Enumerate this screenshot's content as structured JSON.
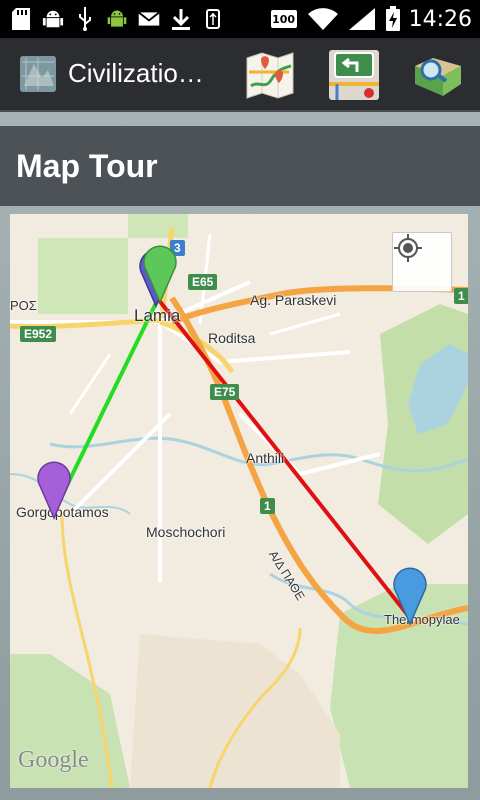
{
  "status_bar": {
    "time": "14:26",
    "battery_label": "100",
    "icons": [
      "sd-card-icon",
      "android-debug-icon",
      "usb-icon",
      "android-icon",
      "gmail-icon",
      "download-icon",
      "usb-connected-icon",
      "battery-100-icon",
      "wifi-icon",
      "signal-icon",
      "battery-charging-icon"
    ]
  },
  "action_bar": {
    "app_title": "Civilizatio…",
    "actions": [
      "map-route-icon",
      "navigation-icon",
      "map-search-icon"
    ]
  },
  "page": {
    "title": "Map Tour"
  },
  "map": {
    "labels": {
      "lamia": "Lamia",
      "ag_paraskevi": "Ag. Paraskevi",
      "roditsa": "Roditsa",
      "anthili": "Anthili",
      "gorgopotamos": "Gorgopotamos",
      "moschochori": "Moschochori",
      "thermopylae": "Thermopylae",
      "road_ay": "Α/Δ ΠΑΘΕ",
      "pros": "ΡΟΣ"
    },
    "shields": {
      "e65": "E65",
      "e952": "E952",
      "e75": "E75",
      "r1": "1",
      "r3": "3",
      "r1_right": "1"
    },
    "attribution": "Google",
    "markers": [
      {
        "name": "Lamia",
        "color": "#5cc85a"
      },
      {
        "name": "Lamia (start)",
        "color": "#5b5cc8"
      },
      {
        "name": "Gorgopotamos",
        "color": "#a55fd8"
      },
      {
        "name": "Thermopylae",
        "color": "#4a9ae0"
      }
    ],
    "routes": [
      {
        "from": "Lamia",
        "to": "Gorgopotamos",
        "color": "#22dd22"
      },
      {
        "from": "Lamia",
        "to": "Thermopylae",
        "color": "#e01010"
      }
    ]
  }
}
